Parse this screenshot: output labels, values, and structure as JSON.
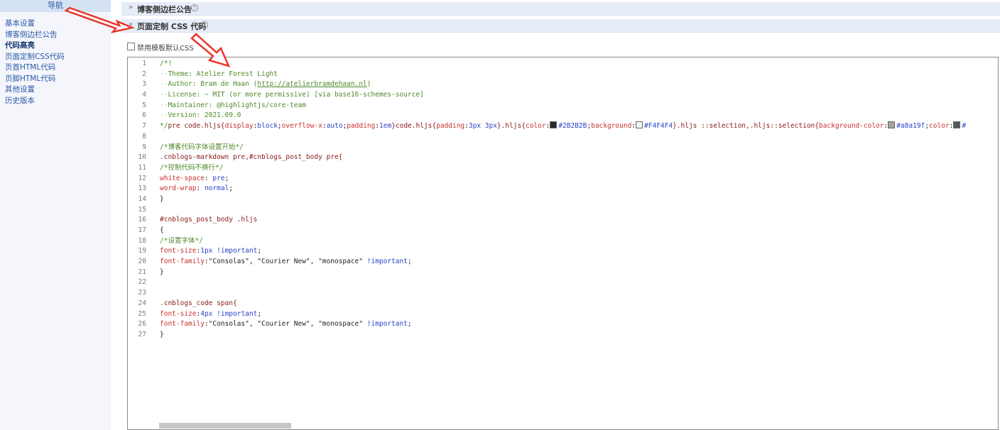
{
  "sidebar": {
    "title": "导航",
    "items": [
      {
        "label": "基本设置"
      },
      {
        "label": "博客侧边栏公告"
      },
      {
        "label": "代码高亮"
      },
      {
        "label": "页面定制CSS代码"
      },
      {
        "label": "页首HTML代码"
      },
      {
        "label": "页脚HTML代码"
      },
      {
        "label": "其他设置"
      },
      {
        "label": "历史版本"
      }
    ]
  },
  "sections": {
    "announcement": {
      "chevron": "»",
      "title": "博客侧边栏公告",
      "help_icon": "?"
    },
    "css": {
      "chevron": "«",
      "title": "页面定制 CSS 代码",
      "help_icon": "?"
    }
  },
  "checkbox": {
    "label": "禁用模板默认CSS",
    "checked": false
  },
  "editor": {
    "lines": [
      {
        "n": "1",
        "t": [
          {
            "c": "cm",
            "s": "/*!"
          }
        ]
      },
      {
        "n": "2",
        "t": [
          {
            "c": "ind",
            "s": "··"
          },
          {
            "c": "cm",
            "s": "Theme: Atelier Forest Light"
          }
        ]
      },
      {
        "n": "3",
        "t": [
          {
            "c": "ind",
            "s": "··"
          },
          {
            "c": "cm",
            "s": "Author: Bram de Haan ("
          },
          {
            "c": "url",
            "s": "http://atelierbramdehaan.nl"
          },
          {
            "c": "cm",
            "s": ")"
          }
        ]
      },
      {
        "n": "4",
        "t": [
          {
            "c": "ind",
            "s": "··"
          },
          {
            "c": "cm",
            "s": "License: ~ MIT (or more permissive) [via base16-schemes-source]"
          }
        ]
      },
      {
        "n": "5",
        "t": [
          {
            "c": "ind",
            "s": "··"
          },
          {
            "c": "cm",
            "s": "Maintainer: @highlightjs/core-team"
          }
        ]
      },
      {
        "n": "6",
        "t": [
          {
            "c": "ind",
            "s": "··"
          },
          {
            "c": "cm",
            "s": "Version: 2021.09.0"
          }
        ]
      },
      {
        "n": "7",
        "t": [
          {
            "c": "cm",
            "s": "*/"
          },
          {
            "c": "sel",
            "s": "pre code.hljs{"
          },
          {
            "c": "prop",
            "s": "display"
          },
          {
            "c": "",
            "s": ":"
          },
          {
            "c": "val",
            "s": "block"
          },
          {
            "c": "",
            "s": ";"
          },
          {
            "c": "prop",
            "s": "overflow-x"
          },
          {
            "c": "",
            "s": ":"
          },
          {
            "c": "val",
            "s": "auto"
          },
          {
            "c": "",
            "s": ";"
          },
          {
            "c": "prop",
            "s": "padding"
          },
          {
            "c": "",
            "s": ":"
          },
          {
            "c": "val",
            "s": "1em"
          },
          {
            "c": "sel",
            "s": "}code.hljs{"
          },
          {
            "c": "prop",
            "s": "padding"
          },
          {
            "c": "",
            "s": ":"
          },
          {
            "c": "val",
            "s": "3px 3px"
          },
          {
            "c": "sel",
            "s": "}.hljs{"
          },
          {
            "c": "prop",
            "s": "color"
          },
          {
            "c": "",
            "s": ":"
          },
          {
            "c": "sw",
            "s": "#2b2b2b"
          },
          {
            "c": "val",
            "s": "#2B2B2B"
          },
          {
            "c": "",
            "s": ";"
          },
          {
            "c": "prop",
            "s": "background"
          },
          {
            "c": "",
            "s": ":"
          },
          {
            "c": "sw",
            "s": "#f4f4f4"
          },
          {
            "c": "val",
            "s": "#F4F4F4"
          },
          {
            "c": "sel",
            "s": "}.hljs ::selection,.hljs::selection{"
          },
          {
            "c": "prop",
            "s": "background-color"
          },
          {
            "c": "",
            "s": ":"
          },
          {
            "c": "sw",
            "s": "#a8a19f"
          },
          {
            "c": "val",
            "s": "#a8a19f"
          },
          {
            "c": "",
            "s": ";"
          },
          {
            "c": "prop",
            "s": "color"
          },
          {
            "c": "",
            "s": ":"
          },
          {
            "c": "sw",
            "s": "#585858"
          },
          {
            "c": "val",
            "s": "#"
          }
        ]
      },
      {
        "n": "8",
        "t": []
      },
      {
        "n": "9",
        "t": [
          {
            "c": "cm",
            "s": "/*博客代码字体设置开始*/"
          }
        ]
      },
      {
        "n": "10",
        "t": [
          {
            "c": "sel",
            "s": ".cnblogs-markdown pre,#cnblogs_post_body pre{"
          }
        ]
      },
      {
        "n": "11",
        "t": [
          {
            "c": "cm",
            "s": "/*控制代码不换行*/"
          }
        ]
      },
      {
        "n": "12",
        "t": [
          {
            "c": "prop",
            "s": "white-space"
          },
          {
            "c": "",
            "s": ": "
          },
          {
            "c": "val",
            "s": "pre"
          },
          {
            "c": "",
            "s": ";"
          }
        ]
      },
      {
        "n": "13",
        "t": [
          {
            "c": "prop",
            "s": "word-wrap"
          },
          {
            "c": "",
            "s": ": "
          },
          {
            "c": "val",
            "s": "normal"
          },
          {
            "c": "",
            "s": ";"
          }
        ]
      },
      {
        "n": "14",
        "t": [
          {
            "c": "",
            "s": "}"
          }
        ]
      },
      {
        "n": "15",
        "t": []
      },
      {
        "n": "16",
        "t": [
          {
            "c": "sel",
            "s": "#cnblogs_post_body .hljs"
          }
        ]
      },
      {
        "n": "17",
        "t": [
          {
            "c": "",
            "s": "{"
          }
        ]
      },
      {
        "n": "18",
        "t": [
          {
            "c": "cm",
            "s": "/*设置字体*/"
          }
        ]
      },
      {
        "n": "19",
        "t": [
          {
            "c": "prop",
            "s": "font-size"
          },
          {
            "c": "",
            "s": ":"
          },
          {
            "c": "val",
            "s": "1px"
          },
          {
            "c": "",
            "s": " "
          },
          {
            "c": "val",
            "s": "!important"
          },
          {
            "c": "",
            "s": ";"
          }
        ]
      },
      {
        "n": "20",
        "t": [
          {
            "c": "prop",
            "s": "font-family"
          },
          {
            "c": "",
            "s": ":\"Consolas\", \"Courier New\", \"monospace\" "
          },
          {
            "c": "val",
            "s": "!important"
          },
          {
            "c": "",
            "s": ";"
          }
        ]
      },
      {
        "n": "21",
        "t": [
          {
            "c": "",
            "s": "}"
          }
        ]
      },
      {
        "n": "22",
        "t": []
      },
      {
        "n": "23",
        "t": []
      },
      {
        "n": "24",
        "t": [
          {
            "c": "sel",
            "s": ".cnblogs_code span{"
          }
        ]
      },
      {
        "n": "25",
        "t": [
          {
            "c": "prop",
            "s": "font-size"
          },
          {
            "c": "",
            "s": ":"
          },
          {
            "c": "val",
            "s": "4px"
          },
          {
            "c": "",
            "s": " "
          },
          {
            "c": "val",
            "s": "!important"
          },
          {
            "c": "",
            "s": ";"
          }
        ]
      },
      {
        "n": "26",
        "t": [
          {
            "c": "prop",
            "s": "font-family"
          },
          {
            "c": "",
            "s": ":\"Consolas\", \"Courier New\", \"monospace\" "
          },
          {
            "c": "val",
            "s": "!important"
          },
          {
            "c": "",
            "s": ";"
          }
        ]
      },
      {
        "n": "27",
        "t": [
          {
            "c": "",
            "s": "}"
          }
        ]
      }
    ]
  },
  "colors": {
    "arrow": "#e8352b",
    "sidebar_link": "#2b5aa8",
    "section_bar": "#e6edf8"
  }
}
